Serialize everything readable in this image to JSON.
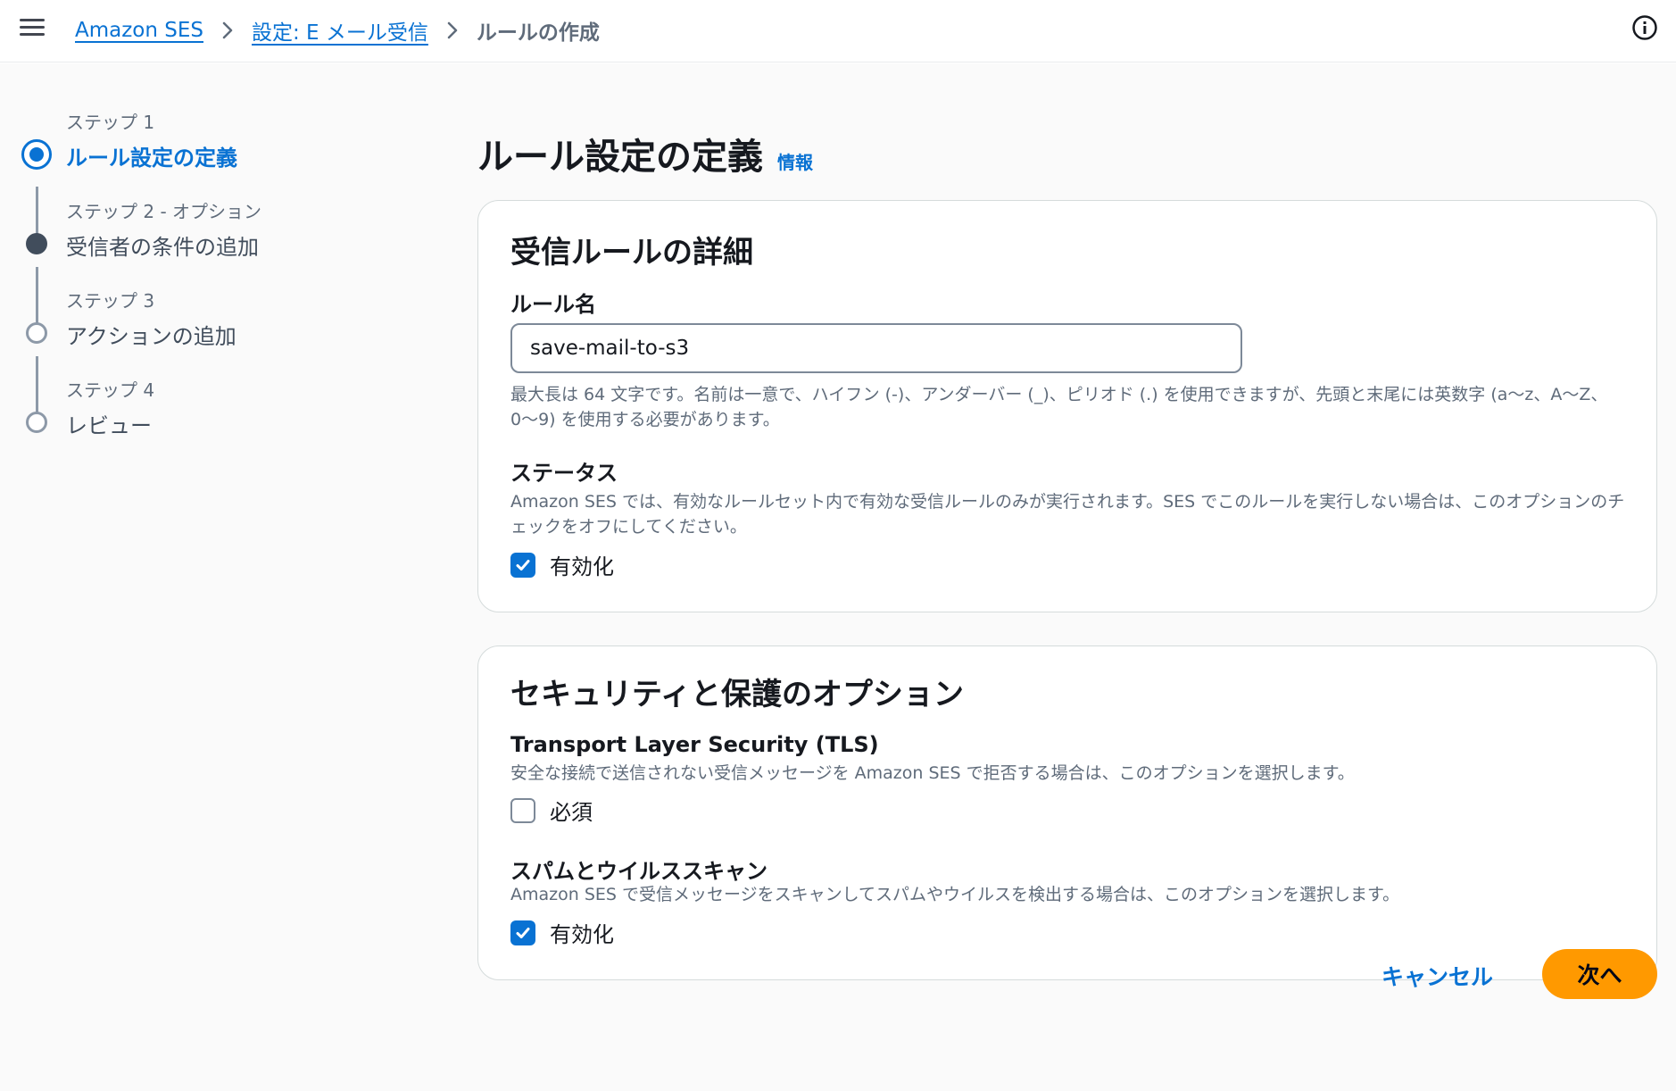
{
  "breadcrumb": {
    "items": [
      "Amazon SES",
      "設定: E メール受信"
    ],
    "current": "ルールの作成"
  },
  "wizard": {
    "steps": [
      {
        "caption": "ステップ 1",
        "label": "ルール設定の定義",
        "state": "active"
      },
      {
        "caption": "ステップ 2 - オプション",
        "label": "受信者の条件の追加",
        "state": "filled"
      },
      {
        "caption": "ステップ 3",
        "label": "アクションの追加",
        "state": "empty"
      },
      {
        "caption": "ステップ 4",
        "label": "レビュー",
        "state": "empty"
      }
    ]
  },
  "page": {
    "title": "ルール設定の定義",
    "info_link": "情報"
  },
  "rule_details": {
    "title": "受信ルールの詳細",
    "name_label": "ルール名",
    "name_value": "save-mail-to-s3",
    "name_hint": "最大長は 64 文字です。名前は一意で、ハイフン (-)、アンダーバー (_)、ピリオド (.) を使用できますが、先頭と末尾には英数字 (a〜z、A〜Z、0〜9) を使用する必要があります。",
    "status_label": "ステータス",
    "status_desc": "Amazon SES では、有効なルールセット内で有効な受信ルールのみが実行されます。SES でこのルールを実行しない場合は、このオプションのチェックをオフにしてください。",
    "status_checkbox_label": "有効化",
    "status_checked": true
  },
  "security": {
    "title": "セキュリティと保護のオプション",
    "tls_label": "Transport Layer Security (TLS)",
    "tls_desc": "安全な接続で送信されない受信メッセージを Amazon SES で拒否する場合は、このオプションを選択します。",
    "tls_checkbox_label": "必須",
    "tls_checked": false,
    "scan_label": "スパムとウイルススキャン",
    "scan_desc": "Amazon SES で受信メッセージをスキャンしてスパムやウイルスを検出する場合は、このオプションを選択します。",
    "scan_checkbox_label": "有効化",
    "scan_checked": true
  },
  "actions": {
    "cancel": "キャンセル",
    "next": "次へ"
  },
  "colors": {
    "accent": "#0972d3",
    "primary_button": "#ff9900"
  }
}
